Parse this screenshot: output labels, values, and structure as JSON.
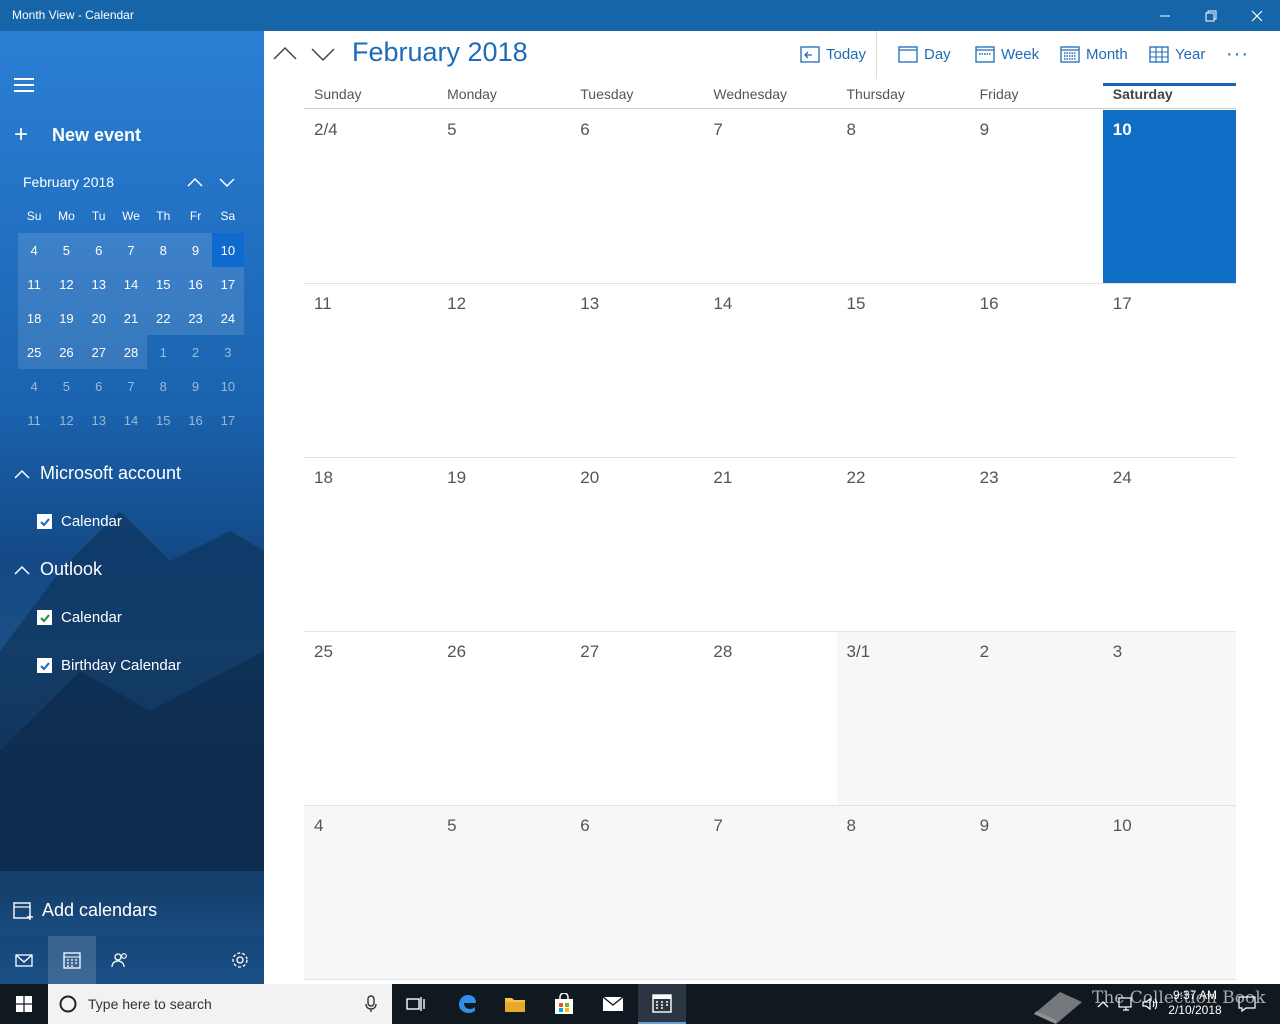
{
  "window": {
    "title": "Month View - Calendar"
  },
  "sidebar": {
    "new_event": "New event",
    "mini_cal": {
      "title": "February 2018",
      "dow": [
        "Su",
        "Mo",
        "Tu",
        "We",
        "Th",
        "Fr",
        "Sa"
      ],
      "weeks": [
        [
          {
            "d": "4",
            "s": "cur"
          },
          {
            "d": "5",
            "s": "cur"
          },
          {
            "d": "6",
            "s": "cur"
          },
          {
            "d": "7",
            "s": "cur"
          },
          {
            "d": "8",
            "s": "cur"
          },
          {
            "d": "9",
            "s": "cur"
          },
          {
            "d": "10",
            "s": "today"
          }
        ],
        [
          {
            "d": "11",
            "s": "cur"
          },
          {
            "d": "12",
            "s": "cur"
          },
          {
            "d": "13",
            "s": "cur"
          },
          {
            "d": "14",
            "s": "cur"
          },
          {
            "d": "15",
            "s": "cur"
          },
          {
            "d": "16",
            "s": "cur"
          },
          {
            "d": "17",
            "s": "cur"
          }
        ],
        [
          {
            "d": "18",
            "s": "cur"
          },
          {
            "d": "19",
            "s": "cur"
          },
          {
            "d": "20",
            "s": "cur"
          },
          {
            "d": "21",
            "s": "cur"
          },
          {
            "d": "22",
            "s": "cur"
          },
          {
            "d": "23",
            "s": "cur"
          },
          {
            "d": "24",
            "s": "cur"
          }
        ],
        [
          {
            "d": "25",
            "s": "cur"
          },
          {
            "d": "26",
            "s": "cur"
          },
          {
            "d": "27",
            "s": "cur"
          },
          {
            "d": "28",
            "s": "cur"
          },
          {
            "d": "1",
            "s": "faded"
          },
          {
            "d": "2",
            "s": "faded"
          },
          {
            "d": "3",
            "s": "faded"
          }
        ],
        [
          {
            "d": "4",
            "s": "faded"
          },
          {
            "d": "5",
            "s": "faded"
          },
          {
            "d": "6",
            "s": "faded"
          },
          {
            "d": "7",
            "s": "faded"
          },
          {
            "d": "8",
            "s": "faded"
          },
          {
            "d": "9",
            "s": "faded"
          },
          {
            "d": "10",
            "s": "faded"
          }
        ],
        [
          {
            "d": "11",
            "s": "faded"
          },
          {
            "d": "12",
            "s": "faded"
          },
          {
            "d": "13",
            "s": "faded"
          },
          {
            "d": "14",
            "s": "faded"
          },
          {
            "d": "15",
            "s": "faded"
          },
          {
            "d": "16",
            "s": "faded"
          },
          {
            "d": "17",
            "s": "faded"
          }
        ]
      ]
    },
    "accounts": [
      {
        "name": "Microsoft account",
        "calendars": [
          {
            "label": "Calendar",
            "checked": true,
            "color": "#1565c0"
          }
        ]
      },
      {
        "name": "Outlook",
        "calendars": [
          {
            "label": "Calendar",
            "checked": true,
            "color": "#1e8a3c"
          },
          {
            "label": "Birthday Calendar",
            "checked": true,
            "color": "#1565c0"
          }
        ]
      }
    ],
    "add_calendars": "Add calendars"
  },
  "toolbar": {
    "month_title": "February 2018",
    "today": "Today",
    "day": "Day",
    "week": "Week",
    "month": "Month",
    "year": "Year",
    "more": "···"
  },
  "month_grid": {
    "dow": [
      "Sunday",
      "Monday",
      "Tuesday",
      "Wednesday",
      "Thursday",
      "Friday",
      "Saturday"
    ],
    "today_index": 6,
    "weeks": [
      [
        {
          "d": "2/4",
          "s": "cur"
        },
        {
          "d": "5",
          "s": "cur"
        },
        {
          "d": "6",
          "s": "cur"
        },
        {
          "d": "7",
          "s": "cur"
        },
        {
          "d": "8",
          "s": "cur"
        },
        {
          "d": "9",
          "s": "cur"
        },
        {
          "d": "10",
          "s": "today"
        }
      ],
      [
        {
          "d": "11",
          "s": "cur"
        },
        {
          "d": "12",
          "s": "cur"
        },
        {
          "d": "13",
          "s": "cur"
        },
        {
          "d": "14",
          "s": "cur"
        },
        {
          "d": "15",
          "s": "cur"
        },
        {
          "d": "16",
          "s": "cur"
        },
        {
          "d": "17",
          "s": "cur"
        }
      ],
      [
        {
          "d": "18",
          "s": "cur"
        },
        {
          "d": "19",
          "s": "cur"
        },
        {
          "d": "20",
          "s": "cur"
        },
        {
          "d": "21",
          "s": "cur"
        },
        {
          "d": "22",
          "s": "cur"
        },
        {
          "d": "23",
          "s": "cur"
        },
        {
          "d": "24",
          "s": "cur"
        }
      ],
      [
        {
          "d": "25",
          "s": "cur"
        },
        {
          "d": "26",
          "s": "cur"
        },
        {
          "d": "27",
          "s": "cur"
        },
        {
          "d": "28",
          "s": "cur"
        },
        {
          "d": "3/1",
          "s": "other"
        },
        {
          "d": "2",
          "s": "other"
        },
        {
          "d": "3",
          "s": "other"
        }
      ],
      [
        {
          "d": "4",
          "s": "other"
        },
        {
          "d": "5",
          "s": "other"
        },
        {
          "d": "6",
          "s": "other"
        },
        {
          "d": "7",
          "s": "other"
        },
        {
          "d": "8",
          "s": "other"
        },
        {
          "d": "9",
          "s": "other"
        },
        {
          "d": "10",
          "s": "other"
        }
      ]
    ]
  },
  "taskbar": {
    "search_placeholder": "Type here to search",
    "time": "9:37 AM",
    "date": "2/10/2018",
    "watermark": "The Collection Book"
  },
  "colors": {
    "accent": "#0f6fc6",
    "titlebar": "#1565a8"
  }
}
